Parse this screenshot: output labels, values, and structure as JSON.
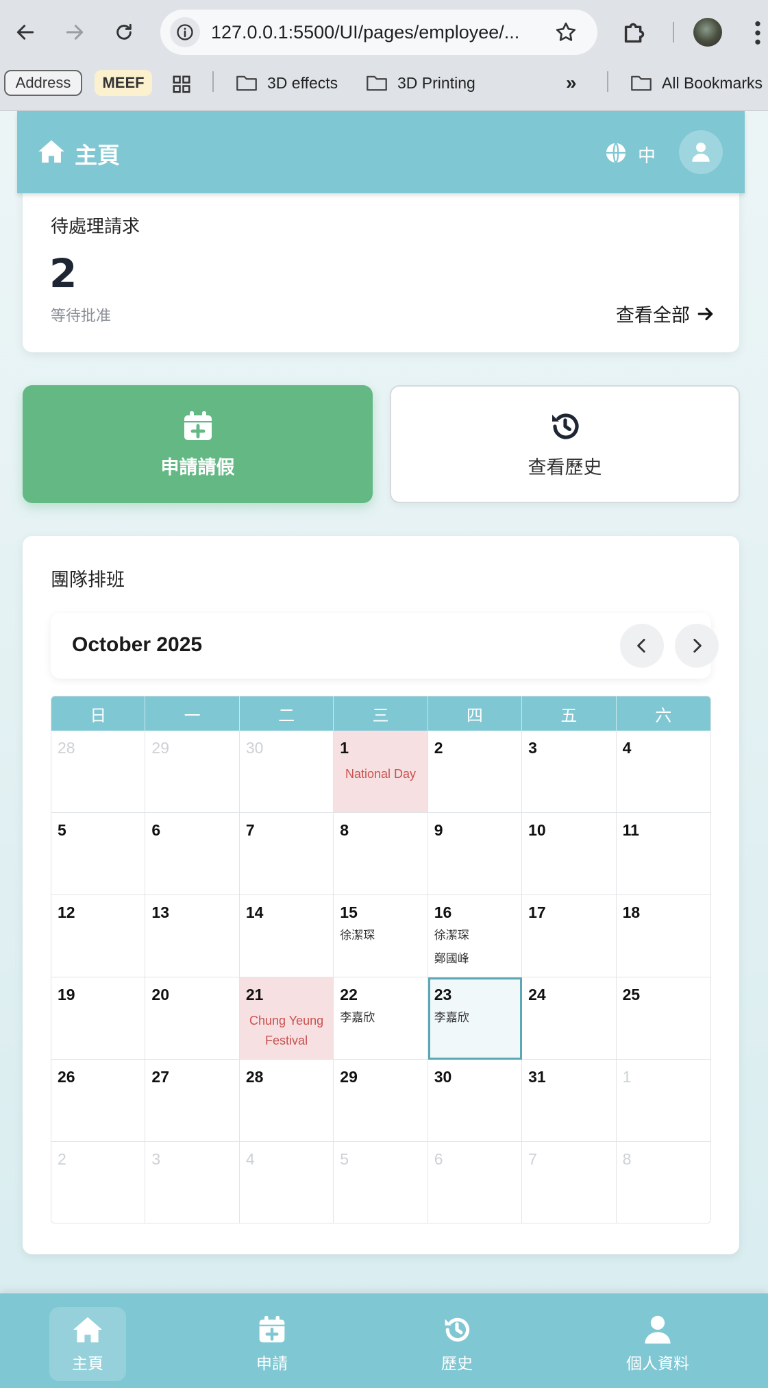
{
  "browser": {
    "url": "127.0.0.1:5500/UI/pages/employee/...",
    "bookmarks": {
      "address": "Address",
      "meef": "MEEF",
      "folder1": "3D effects",
      "folder2": "3D Printing",
      "more": "»",
      "all": "All Bookmarks"
    }
  },
  "header": {
    "title": "主頁",
    "lang": "中"
  },
  "pending": {
    "title": "待處理請求",
    "count": "2",
    "subtitle": "等待批准",
    "link": "查看全部"
  },
  "actions": {
    "apply": "申請請假",
    "history": "查看歷史"
  },
  "roster": {
    "title": "團隊排班",
    "month": "October 2025",
    "weekdays": [
      "日",
      "一",
      "二",
      "三",
      "四",
      "五",
      "六"
    ],
    "cells": [
      {
        "d": "28",
        "other": true
      },
      {
        "d": "29",
        "other": true
      },
      {
        "d": "30",
        "other": true
      },
      {
        "d": "1",
        "holiday": "National Day"
      },
      {
        "d": "2"
      },
      {
        "d": "3"
      },
      {
        "d": "4"
      },
      {
        "d": "5"
      },
      {
        "d": "6"
      },
      {
        "d": "7"
      },
      {
        "d": "8"
      },
      {
        "d": "9"
      },
      {
        "d": "10"
      },
      {
        "d": "11"
      },
      {
        "d": "12"
      },
      {
        "d": "13"
      },
      {
        "d": "14"
      },
      {
        "d": "15",
        "duty": [
          "徐潔琛"
        ]
      },
      {
        "d": "16",
        "duty": [
          "徐潔琛",
          "鄭國峰"
        ]
      },
      {
        "d": "17"
      },
      {
        "d": "18"
      },
      {
        "d": "19"
      },
      {
        "d": "20"
      },
      {
        "d": "21",
        "holiday": "Chung Yeung Festival"
      },
      {
        "d": "22",
        "duty": [
          "李嘉欣"
        ]
      },
      {
        "d": "23",
        "duty": [
          "李嘉欣"
        ],
        "today": true
      },
      {
        "d": "24"
      },
      {
        "d": "25"
      },
      {
        "d": "26"
      },
      {
        "d": "27"
      },
      {
        "d": "28"
      },
      {
        "d": "29"
      },
      {
        "d": "30"
      },
      {
        "d": "31"
      },
      {
        "d": "1",
        "other": true
      },
      {
        "d": "2",
        "other": true
      },
      {
        "d": "3",
        "other": true
      },
      {
        "d": "4",
        "other": true
      },
      {
        "d": "5",
        "other": true
      },
      {
        "d": "6",
        "other": true
      },
      {
        "d": "7",
        "other": true
      },
      {
        "d": "8",
        "other": true
      }
    ]
  },
  "bottom_nav": {
    "home": "主頁",
    "apply": "申請",
    "history": "歷史",
    "profile": "個人資料"
  },
  "colors": {
    "accent": "#7fc7d3",
    "apply_green": "#63b884",
    "holiday_bg": "#f6e0e2",
    "holiday_text": "#c9524f",
    "today_border": "#5ba7b3"
  }
}
